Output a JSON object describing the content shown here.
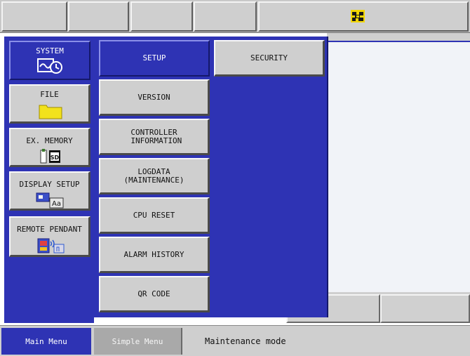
{
  "top_bar": {
    "buttons": [
      "",
      "",
      "",
      ""
    ],
    "status_icon": "robot-status-icon"
  },
  "main_menu": {
    "items": [
      {
        "label": "SYSTEM",
        "icon": "system-icon",
        "selected": true
      },
      {
        "label": "FILE",
        "icon": "folder-icon",
        "selected": false
      },
      {
        "label": "EX. MEMORY",
        "icon": "sd-card-icon",
        "selected": false
      },
      {
        "label": "DISPLAY SETUP",
        "icon": "display-setup-icon",
        "selected": false
      },
      {
        "label": "REMOTE PENDANT",
        "icon": "remote-pendant-icon",
        "selected": false
      }
    ]
  },
  "sub_menu": {
    "items": [
      {
        "label": "SETUP",
        "selected": true
      },
      {
        "label": "VERSION"
      },
      {
        "label": "CONTROLLER\n INFORMATION"
      },
      {
        "label": "LOGDATA\n(MAINTENANCE)"
      },
      {
        "label": "CPU RESET"
      },
      {
        "label": "ALARM HISTORY"
      },
      {
        "label": "QR CODE"
      }
    ],
    "child": {
      "label": "SECURITY"
    }
  },
  "bottom_bar": {
    "main_menu": "Main Menu",
    "simple_menu": "Simple Menu",
    "status": "Maintenance mode"
  },
  "colors": {
    "menu_blue": "#2e33b4",
    "button_gray": "#cfcfcf",
    "work_area": "#f1f3f8"
  }
}
